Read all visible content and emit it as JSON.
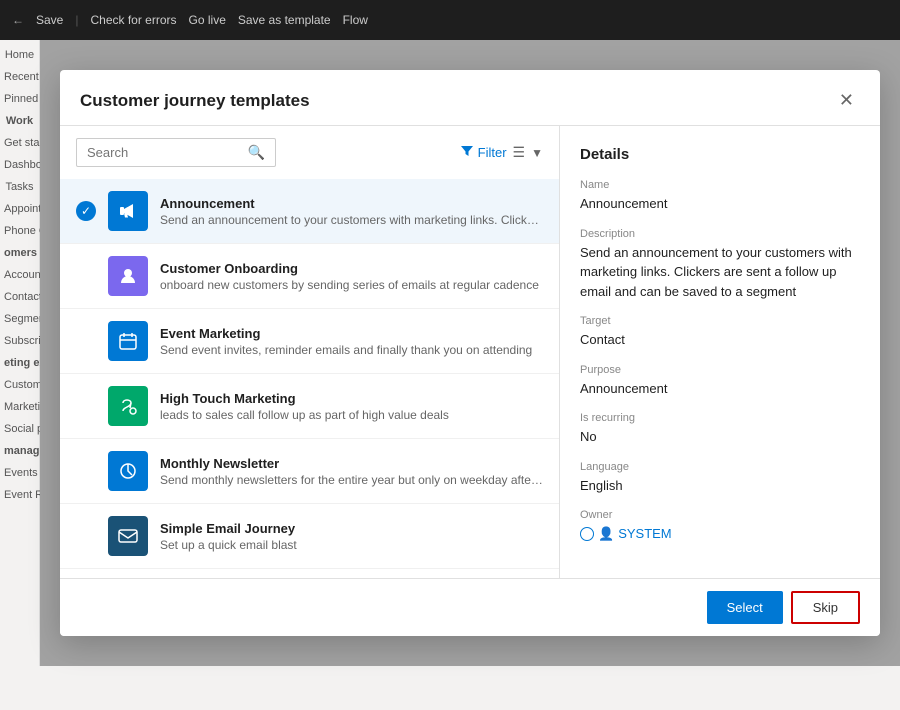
{
  "app": {
    "topbar": {
      "back_icon": "←",
      "save_label": "Save",
      "check_errors_label": "Check for errors",
      "go_live_label": "Go live",
      "save_as_template_label": "Save as template",
      "flow_label": "Flow"
    }
  },
  "sidebar": {
    "items": [
      {
        "label": "Home"
      },
      {
        "label": "Recent"
      },
      {
        "label": "Pinned"
      },
      {
        "label": "Work"
      },
      {
        "label": "Get start"
      },
      {
        "label": "Dashbo"
      },
      {
        "label": "Tasks"
      },
      {
        "label": "Appoint"
      },
      {
        "label": "Phone C"
      },
      {
        "label": "omers"
      },
      {
        "label": "Account"
      },
      {
        "label": "Contact"
      },
      {
        "label": "Segment"
      },
      {
        "label": "Subscri"
      },
      {
        "label": "eting ex"
      },
      {
        "label": "Custome"
      },
      {
        "label": "Marketi"
      },
      {
        "label": "Social p"
      },
      {
        "label": "manage"
      },
      {
        "label": "Events"
      },
      {
        "label": "Event Re"
      }
    ]
  },
  "dialog": {
    "title": "Customer journey templates",
    "close_icon": "✕",
    "search": {
      "placeholder": "Search",
      "icon": "🔍"
    },
    "filter": {
      "label": "Filter",
      "icon": "▼"
    },
    "templates": [
      {
        "id": "announcement",
        "name": "Announcement",
        "description": "Send an announcement to your customers with marketing links. Clickers are sent a...",
        "icon_char": "📢",
        "icon_bg": "#0078d4",
        "selected": true
      },
      {
        "id": "customer-onboarding",
        "name": "Customer Onboarding",
        "description": "onboard new customers by sending series of emails at regular cadence",
        "icon_char": "👤",
        "icon_bg": "#7b68ee",
        "selected": false
      },
      {
        "id": "event-marketing",
        "name": "Event Marketing",
        "description": "Send event invites, reminder emails and finally thank you on attending",
        "icon_char": "📅",
        "icon_bg": "#0078d4",
        "selected": false
      },
      {
        "id": "high-touch-marketing",
        "name": "High Touch Marketing",
        "description": "leads to sales call follow up as part of high value deals",
        "icon_char": "📞",
        "icon_bg": "#00a86b",
        "selected": false
      },
      {
        "id": "monthly-newsletter",
        "name": "Monthly Newsletter",
        "description": "Send monthly newsletters for the entire year but only on weekday afternoons",
        "icon_char": "🔄",
        "icon_bg": "#0078d4",
        "selected": false
      },
      {
        "id": "simple-email-journey",
        "name": "Simple Email Journey",
        "description": "Set up a quick email blast",
        "icon_char": "✉",
        "icon_bg": "#0078d4",
        "selected": false
      }
    ],
    "details": {
      "heading": "Details",
      "name_label": "Name",
      "name_value": "Announcement",
      "description_label": "Description",
      "description_value": "Send an announcement to your customers with marketing links. Clickers are sent a follow up email and can be saved to a segment",
      "target_label": "Target",
      "target_value": "Contact",
      "purpose_label": "Purpose",
      "purpose_value": "Announcement",
      "is_recurring_label": "Is recurring",
      "is_recurring_value": "No",
      "language_label": "Language",
      "language_value": "English",
      "owner_label": "Owner",
      "owner_value": "SYSTEM"
    },
    "footer": {
      "select_label": "Select",
      "skip_label": "Skip"
    }
  }
}
